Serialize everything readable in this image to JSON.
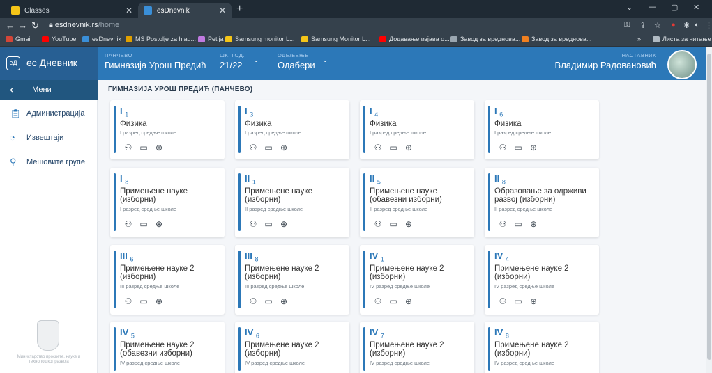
{
  "browser": {
    "tabs": [
      {
        "title": "Classes",
        "active": false,
        "favicon_color": "#f5c518"
      },
      {
        "title": "esDnevnik",
        "active": true,
        "favicon_color": "#3a8fd8"
      }
    ],
    "url_host": "esdnevnik.rs",
    "url_path": "/home",
    "bookmarks": [
      {
        "label": "Gmail",
        "color": "#d44638"
      },
      {
        "label": "YouTube",
        "color": "#ff0000"
      },
      {
        "label": "esDnevnik",
        "color": "#3a8fd8"
      },
      {
        "label": "MS Postolje za hlad...",
        "color": "#e0a000"
      },
      {
        "label": "Petlja",
        "color": "#c07ae0"
      },
      {
        "label": "Samsung monitor L...",
        "color": "#f5c518"
      },
      {
        "label": "Samsung Monitor L...",
        "color": "#f5c518"
      },
      {
        "label": "Додавање изјава о...",
        "color": "#ff0000"
      },
      {
        "label": "Завод за вреднова...",
        "color": "#9aa6b0"
      },
      {
        "label": "Завод за вреднова...",
        "color": "#f08020"
      }
    ],
    "reading_list": "Листа за читање"
  },
  "header": {
    "brand": "ес Дневник",
    "brand_icon": "еД",
    "school_label": "ПАНЧЕВО",
    "school_value": "Гимназија Урош Предић",
    "year_label": "ШК. ГОД.",
    "year_value": "21/22",
    "dept_label": "ОДЕЉЕЊЕ",
    "dept_value": "Одабери",
    "role_label": "НАСТАВНИК",
    "teacher_name": "Владимир Радовановић"
  },
  "sidebar": {
    "menu_label": "Мени",
    "items": [
      {
        "label": "Администрација",
        "icon": "clipboard-icon"
      },
      {
        "label": "Извештаји",
        "icon": "pie-chart-icon"
      },
      {
        "label": "Мешовите групе",
        "icon": "hierarchy-icon"
      }
    ],
    "ministry_text": "Министарство просвете, науке и технолошког развоја"
  },
  "main": {
    "school_title": "ГИМНАЗИЈА УРОШ ПРЕДИЋ (ПАНЧЕВО)",
    "cards": [
      {
        "cls": "I",
        "sub": "1",
        "subject": "Физика",
        "grade": "I разред средње школе"
      },
      {
        "cls": "I",
        "sub": "3",
        "subject": "Физика",
        "grade": "I разред средње школе"
      },
      {
        "cls": "I",
        "sub": "4",
        "subject": "Физика",
        "grade": "I разред средње школе"
      },
      {
        "cls": "I",
        "sub": "6",
        "subject": "Физика",
        "grade": "I разред средње школе"
      },
      {
        "cls": "I",
        "sub": "8",
        "subject": "Примењене науке (изборни)",
        "grade": "I разред средње школе"
      },
      {
        "cls": "II",
        "sub": "1",
        "subject": "Примењене науке (изборни)",
        "grade": "II разред средње школе"
      },
      {
        "cls": "II",
        "sub": "5",
        "subject": "Примењене науке (обавезни изборни)",
        "grade": "II разред средње школе"
      },
      {
        "cls": "II",
        "sub": "8",
        "subject": "Образовање за одрживи развој (изборни)",
        "grade": "II разред средње школе"
      },
      {
        "cls": "III",
        "sub": "6",
        "subject": "Примењене науке 2 (изборни)",
        "grade": "III разред средње школе"
      },
      {
        "cls": "III",
        "sub": "8",
        "subject": "Примењене науке 2 (изборни)",
        "grade": "III разред средње школе"
      },
      {
        "cls": "IV",
        "sub": "1",
        "subject": "Примењене науке 2 (изборни)",
        "grade": "IV разред средње школе"
      },
      {
        "cls": "IV",
        "sub": "4",
        "subject": "Примењене науке 2 (изборни)",
        "grade": "IV разред средње школе"
      },
      {
        "cls": "IV",
        "sub": "5",
        "subject": "Примењене науке 2 (обавезни изборни)",
        "grade": "IV разред средње школе"
      },
      {
        "cls": "IV",
        "sub": "6",
        "subject": "Примењене науке 2 (изборни)",
        "grade": "IV разред средње школе"
      },
      {
        "cls": "IV",
        "sub": "7",
        "subject": "Примењене науке 2 (изборни)",
        "grade": "IV разред средње школе"
      },
      {
        "cls": "IV",
        "sub": "8",
        "subject": "Примењене науке 2 (изборни)",
        "grade": "IV разред средње школе"
      }
    ],
    "card_actions": [
      "students-icon",
      "book-icon",
      "add-circle-icon"
    ]
  }
}
